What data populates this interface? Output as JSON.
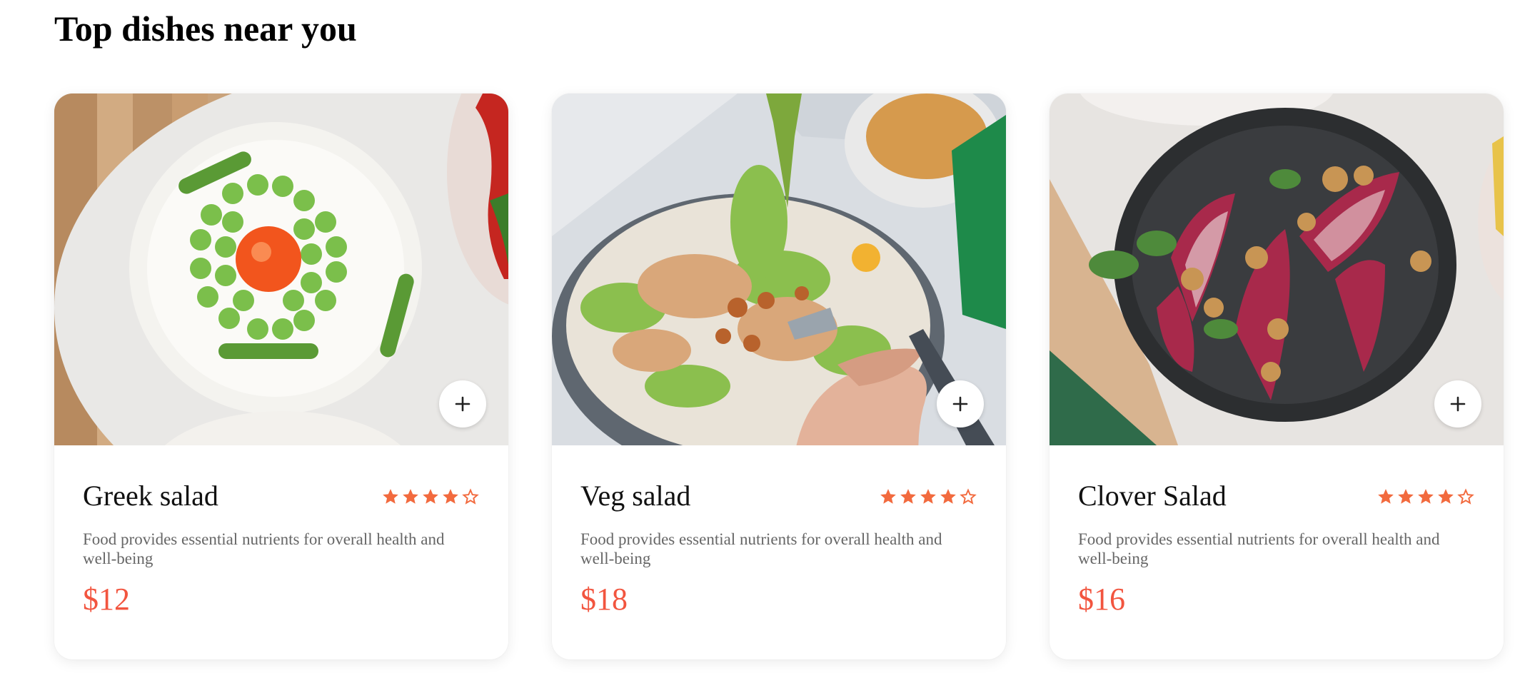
{
  "page": {
    "title": "Top dishes near you"
  },
  "colors": {
    "accent": "#f2553f",
    "star": "#f26a3e",
    "text_muted": "#666666"
  },
  "cards": [
    {
      "name": "Greek salad",
      "rating": 4,
      "rating_max": 5,
      "description": "Food provides essential nutrients for overall health and well-being",
      "price": "$12",
      "image_icon": "asparagus-egg-plate-image"
    },
    {
      "name": "Veg salad",
      "rating": 4,
      "rating_max": 5,
      "description": "Food provides essential nutrients for overall health and well-being",
      "price": "$18",
      "image_icon": "mixed-salad-plate-image"
    },
    {
      "name": "Clover Salad",
      "rating": 4,
      "rating_max": 5,
      "description": "Food provides essential nutrients for overall health and well-being",
      "price": "$16",
      "image_icon": "endive-walnut-plate-image"
    }
  ],
  "icons": {
    "add": "plus-icon",
    "star_filled": "star-filled-icon",
    "star_empty": "star-outline-icon"
  }
}
